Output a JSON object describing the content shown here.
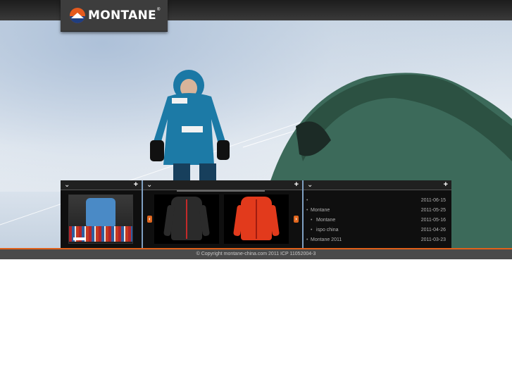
{
  "brand": {
    "name": "MONTANE",
    "registered": "®"
  },
  "panels": {
    "video": {
      "collapse_icon": "chevron-down-icon",
      "more_label": "+"
    },
    "products": {
      "collapse_icon": "chevron-down-icon",
      "more_label": "+",
      "prev_label": "‹",
      "next_label": "›"
    },
    "news": {
      "collapse_icon": "chevron-down-icon",
      "more_label": "+",
      "items": [
        {
          "title": "",
          "date": "2011-06-15",
          "indent": false
        },
        {
          "title": "Montane",
          "date": "2011-05-25",
          "indent": false
        },
        {
          "title": "Montane",
          "date": "2011-05-16",
          "indent": true
        },
        {
          "title": "ispo china",
          "date": "2011-04-26",
          "indent": true
        },
        {
          "title": "Montane    2011",
          "date": "2011-03-23",
          "indent": false
        }
      ]
    }
  },
  "footer": {
    "copyright": "© Copyright montane-china.com 2011  ICP 11052004-3"
  },
  "colors": {
    "accent": "#e0601a",
    "panel_bg": "#0f0f0f",
    "separator": "#7fa0c2"
  }
}
